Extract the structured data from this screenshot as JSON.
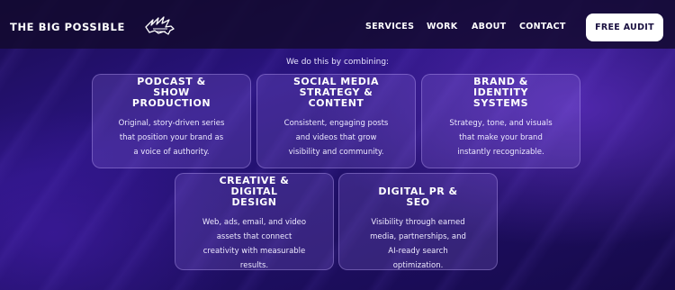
{
  "header": {
    "brand": "THE BIG POSSIBLE",
    "logo_icon": "winged-lion-logo-icon",
    "nav": [
      "SERVICES",
      "WORK",
      "ABOUT",
      "CONTACT"
    ],
    "cta": "FREE AUDIT"
  },
  "main": {
    "lead": "We do this by combining:",
    "cards": [
      {
        "title": "PODCAST &\nSHOW\nPRODUCTION",
        "body": "Original, story-driven series\nthat position your brand as\na voice of authority."
      },
      {
        "title": "SOCIAL MEDIA\nSTRATEGY &\nCONTENT",
        "body": "Consistent, engaging posts\nand videos that grow\nvisibility and community."
      },
      {
        "title": "BRAND &\nIDENTITY\nSYSTEMS",
        "body": "Strategy, tone, and visuals\nthat make your brand\ninstantly recognizable."
      },
      {
        "title": "CREATIVE &\nDIGITAL\nDESIGN",
        "body": "Web, ads, email, and video\nassets that connect\ncreativity with measurable\nresults."
      },
      {
        "title": "DIGITAL PR &\nSEO",
        "body": "Visibility through earned\nmedia, partnerships, and\nAI-ready search\noptimization."
      }
    ]
  },
  "colors": {
    "background": "#2a1480",
    "header": "#120a2d",
    "cta_bg": "#ffffff",
    "cta_text": "#1a1040"
  }
}
